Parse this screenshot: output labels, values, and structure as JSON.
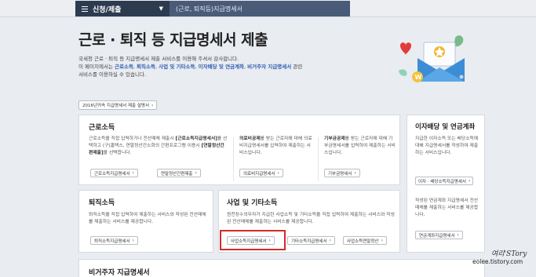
{
  "nav": {
    "menu_label": "신청/제출",
    "crumb": "(근로, 퇴직등)지급명세서"
  },
  "hero": {
    "title": "근로 · 퇴직 등 지급명세서 제출",
    "intro_line1": "국세청 근로 · 퇴직 등 지급명세서 제출 서비스를 이용해 주셔서 감사합니다.",
    "intro_prefix": "이 페이지에서는 ",
    "intro_items": [
      "근로소득",
      "퇴직소득",
      "사업 및 기타소득",
      "이자배당 및 연금계좌",
      "비거주자 지급명세서"
    ],
    "intro_suffix_1": " 관련",
    "intro_line3": "서비스를 이용하실 수 있습니다."
  },
  "guide_button": "2016년귀속 지급명세서 제출 설명서",
  "cards": {
    "earned": {
      "title": "근로소득",
      "desc_a": "근로소득을 직접 입력하거나 전산매체 제출시 ",
      "desc_b": "[근로소득지급명세서]",
      "desc_c": "를 선택하고 (구)홈택스, 연말정산간소화의 간편프로그램 이용시 ",
      "desc_d": "[연말정산간편제출]",
      "desc_e": "을 선택합니다.",
      "btn1": "근로소득지급명세서",
      "btn2": "연말정산간편제출",
      "medical_title": "의료비공제",
      "medical_desc": "를 받는 근로자에 대해 의료비지급명세서를 입력하여 제출하는 서비스입니다.",
      "medical_btn": "의료비지급명세서",
      "donation_title": "기부금공제",
      "donation_desc": "를 받는 근로자에 대해 기부금명세서를 입력하여 제출하는 서비스입니다.",
      "donation_btn": "기부금명세서"
    },
    "interest": {
      "title": "이자배당 및 연금계좌",
      "desc": "지급한 이자소득 또는 배당소득에 대해 지급명세서를 작성하여 제출하는 서비스입니다.",
      "btn": "이자 · 배당소득지급명세서",
      "desc2": "작성된 연금계좌 지급명세서 전산매체를 제출하는 서비스를 제공합니다.",
      "btn2": "연금계좌지급명세서"
    },
    "retire": {
      "title": "퇴직소득",
      "desc": "퇴직소득을 직접 입력하여 제출하는 서비스와 작성된 전산매체를 제출하는 서비스를 제공합니다.",
      "btn": "퇴직소득지급명세서"
    },
    "business": {
      "title": "사업 및 기타소득",
      "desc": "원천징수의무자가 지급한 사업소득 및 기타소득을 직접 입력하여 제출하는 서비스와 작성된 전산매체를 제출하는 서비스를 제공합니다.",
      "btn1": "사업소득지급명세서",
      "btn2": "기타소득지급명세서",
      "btn3": "사업소득연말정산"
    },
    "nonresident": {
      "title": "비거주자 지급명세서"
    }
  },
  "watermark": {
    "line1": "여리'STory",
    "line2": "eolee.tistory.com"
  },
  "colors": {
    "nav_dark": "#2d3b50",
    "nav_crumb": "#4a5b78",
    "highlight_link": "#2f5fb3",
    "annotation_red": "#d62a2a"
  }
}
